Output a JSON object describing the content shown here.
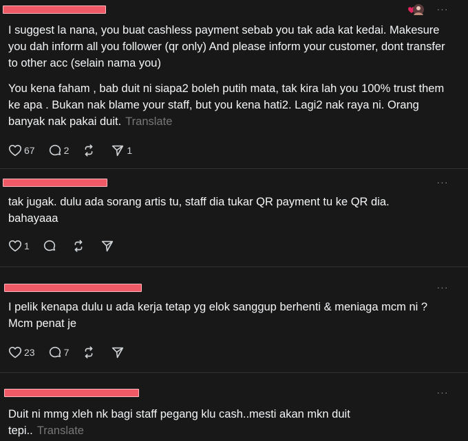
{
  "posts": [
    {
      "paragraphs": [
        "I suggest la nana, you buat cashless payment sebab you tak ada kat kedai. Makesure you dah inform all you follower (qr only) And please inform your customer, dont transfer to other acc (selain nama you)",
        "You kena faham , bab duit ni siapa2 boleh putih mata, tak kira lah you 100% trust them ke apa . Bukan nak blame your staff, but you kena hati2. Lagi2 nak raya ni. Orang banyak nak pakai duit."
      ],
      "translate_label": "Translate",
      "likes": "67",
      "replies": "2",
      "reposts": "",
      "shares": "1"
    },
    {
      "paragraphs": [
        "tak jugak. dulu ada sorang artis tu, staff dia tukar QR payment tu ke QR dia. bahayaaa"
      ],
      "likes": "1",
      "replies": "",
      "reposts": "",
      "shares": ""
    },
    {
      "paragraphs": [
        "I pelik kenapa dulu u ada kerja tetap yg elok sanggup berhenti & meniaga mcm ni ? Mcm penat je"
      ],
      "likes": "23",
      "replies": "7",
      "reposts": "",
      "shares": ""
    },
    {
      "paragraphs": [
        "Duit ni mmg xleh nk bagi staff pegang klu cash..mesti akan mkn duit tepi.."
      ],
      "translate_label": "Translate"
    }
  ],
  "more_glyph": "···",
  "icons": {
    "like": "heart-icon",
    "reply": "comment-icon",
    "repost": "repost-icon",
    "share": "send-icon",
    "more": "more-options-icon"
  },
  "colors": {
    "background": "#181818",
    "text": "#f3f5f7",
    "muted": "#777777",
    "redaction": "#f05a66",
    "divider": "#323232"
  }
}
